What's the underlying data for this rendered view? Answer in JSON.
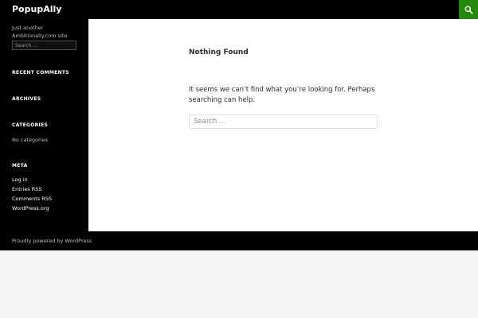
{
  "header": {
    "site_title": "PopupAlly",
    "search_icon": "search-icon",
    "accent_color": "#24890d"
  },
  "sidebar": {
    "tagline": "Just another Ambitionally.com site",
    "search_placeholder": "Search …",
    "recent_comments_title": "RECENT COMMENTS",
    "archives_title": "ARCHIVES",
    "categories_title": "CATEGORIES",
    "categories_empty": "No categories",
    "meta_title": "META",
    "meta_links": [
      "Log in",
      "Entries RSS",
      "Comments RSS",
      "WordPress.org"
    ]
  },
  "main": {
    "title": "Nothing Found",
    "message": "It seems we can’t find what you’re looking for. Perhaps searching can help.",
    "search_placeholder": "Search …"
  },
  "footer": {
    "credit": "Proudly powered by WordPress"
  }
}
